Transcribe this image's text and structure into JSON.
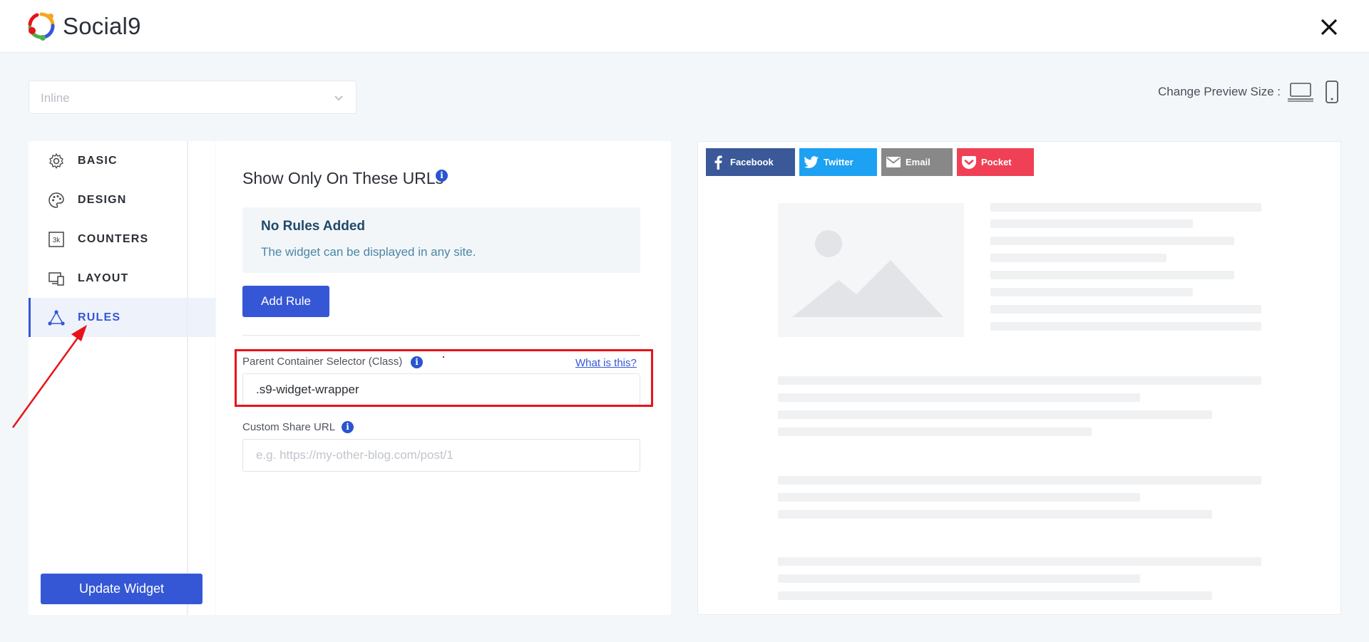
{
  "app": {
    "brand": "Social9"
  },
  "layout_select": {
    "value": "Inline"
  },
  "preview_size": {
    "label": "Change Preview Size :"
  },
  "sidebar": {
    "items": [
      {
        "label": "BASIC",
        "icon": "gear-icon"
      },
      {
        "label": "DESIGN",
        "icon": "palette-icon"
      },
      {
        "label": "COUNTERS",
        "icon": "counter-3k-icon",
        "icon_text": "3k"
      },
      {
        "label": "LAYOUT",
        "icon": "devices-icon"
      },
      {
        "label": "RULES",
        "icon": "rules-triangle-icon",
        "active": true
      }
    ],
    "update_button": "Update Widget"
  },
  "rules": {
    "section_title": "Show Only On These URLs",
    "empty_title": "No Rules Added",
    "empty_text": "The widget can be displayed in any site.",
    "add_rule_button": "Add Rule",
    "parent_selector_label": "Parent Container Selector (Class)",
    "what_is_this": "What is this?",
    "parent_selector_value": ".s9-widget-wrapper",
    "custom_url_label": "Custom Share URL",
    "custom_url_placeholder": "e.g. https://my-other-blog.com/post/1"
  },
  "preview": {
    "share_buttons": [
      {
        "label": "Facebook",
        "color": "#3b5998",
        "icon": "facebook-icon"
      },
      {
        "label": "Twitter",
        "color": "#1da1f2",
        "icon": "twitter-icon"
      },
      {
        "label": "Email",
        "color": "#888888",
        "icon": "email-icon"
      },
      {
        "label": "Pocket",
        "color": "#ef4056",
        "icon": "pocket-icon"
      }
    ]
  },
  "colors": {
    "accent": "#3557d6",
    "highlight": "#e8131a",
    "info_icon": "#2a54d0"
  }
}
